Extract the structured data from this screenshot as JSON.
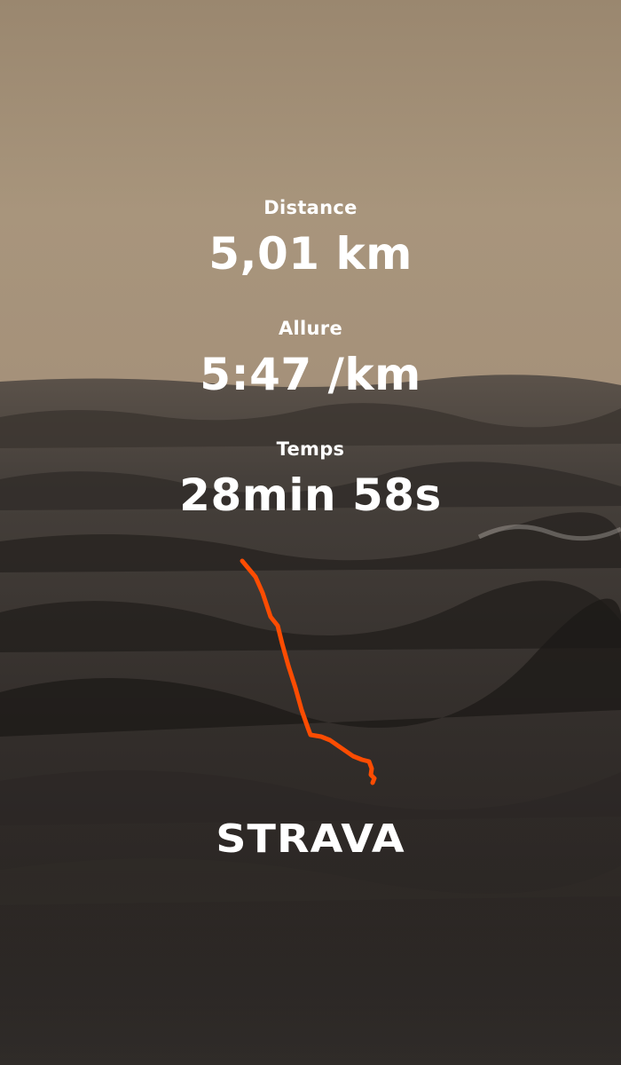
{
  "stats": {
    "distance": {
      "label": "Distance",
      "value": "5,01 km"
    },
    "pace": {
      "label": "Allure",
      "value": "5:47 /km"
    },
    "time": {
      "label": "Temps",
      "value": "28min 58s"
    }
  },
  "brand": {
    "logo_text": "STRAVA"
  },
  "route": {
    "color": "#fc4c02",
    "icon": "route-polyline"
  },
  "background": {
    "description_icon": "stormy-sea-photo",
    "sky_color": "#a8957c",
    "sea_color": "#2e2a27"
  }
}
